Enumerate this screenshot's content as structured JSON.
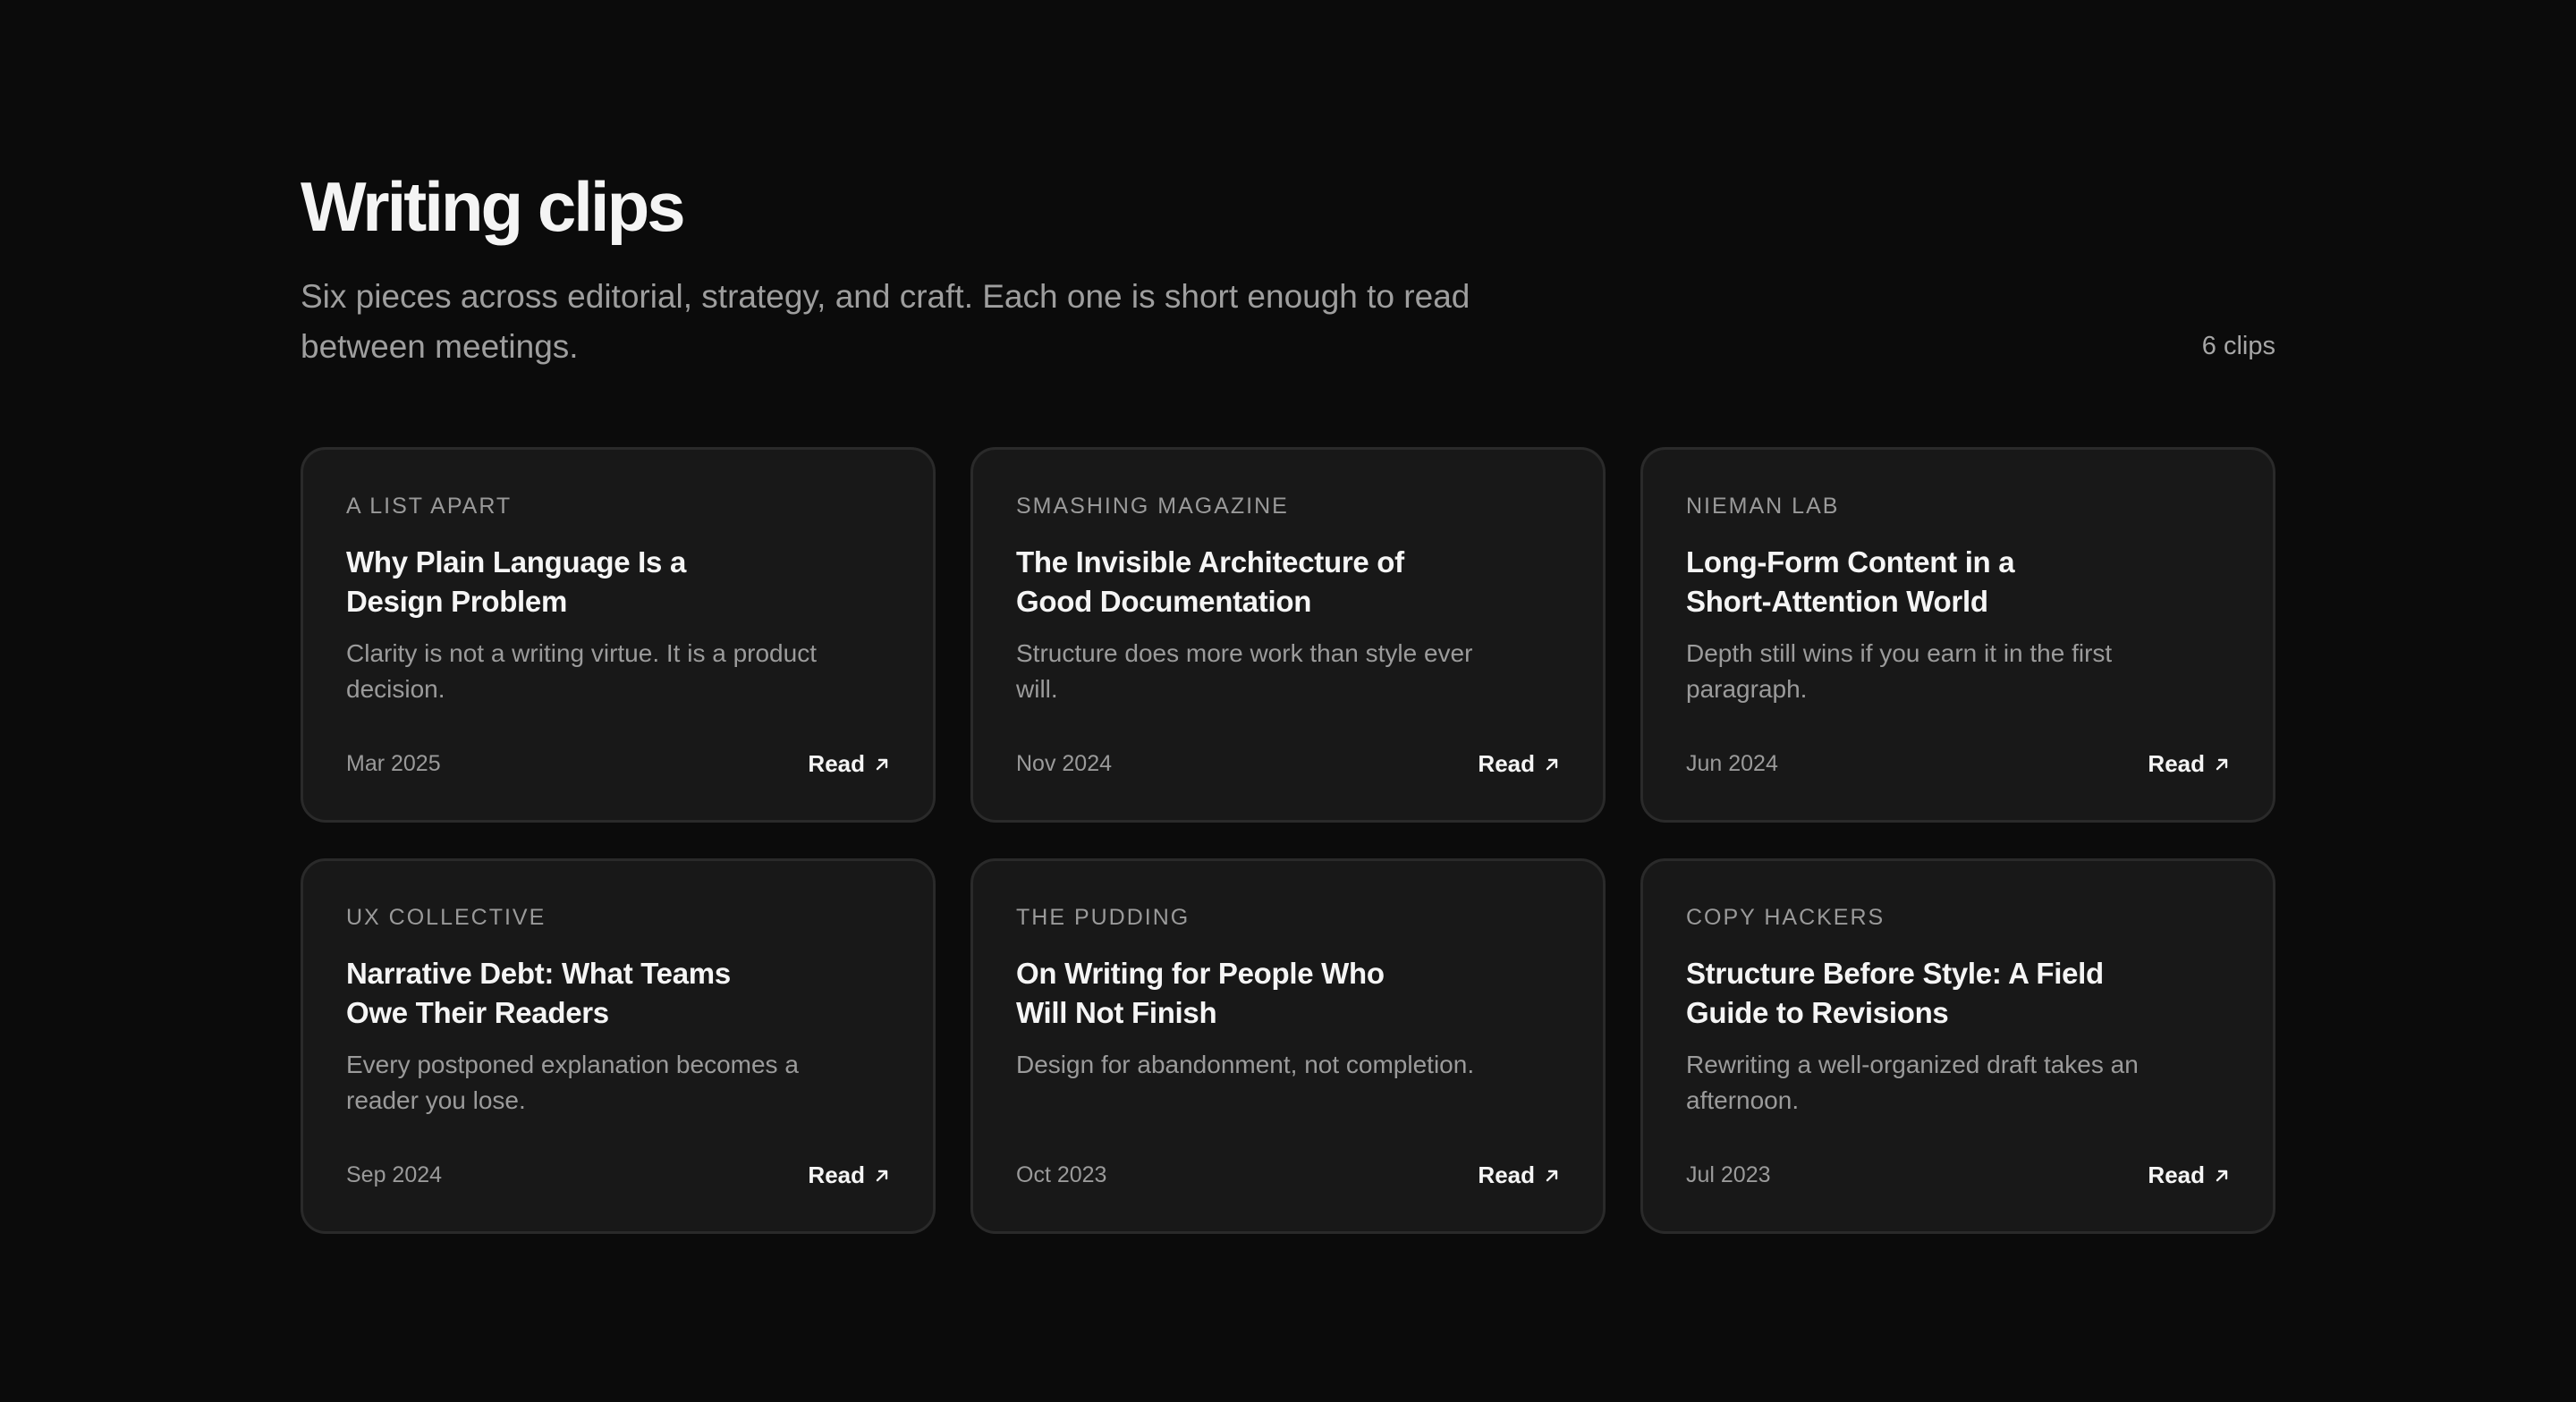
{
  "header": {
    "title": "Writing clips",
    "subtitle": "Six pieces across editorial, strategy, and craft. Each one is short enough to read between meetings.",
    "count": "6 clips"
  },
  "clips": [
    {
      "source": "A LIST APART",
      "title": "Why Plain Language Is a Design Problem",
      "description": "Clarity is not a writing virtue. It is a product decision.",
      "date": "Mar 2025",
      "link_label": "Read",
      "link_icon": "arrow-up-right-icon"
    },
    {
      "source": "SMASHING MAGAZINE",
      "title": "The Invisible Architecture of Good Documentation",
      "description": "Structure does more work than style ever will.",
      "date": "Nov 2024",
      "link_label": "Read",
      "link_icon": "arrow-up-right-icon"
    },
    {
      "source": "NIEMAN LAB",
      "title": "Long-Form Content in a Short-Attention World",
      "description": "Depth still wins if you earn it in the first paragraph.",
      "date": "Jun 2024",
      "link_label": "Read",
      "link_icon": "arrow-up-right-icon"
    },
    {
      "source": "UX COLLECTIVE",
      "title": "Narrative Debt: What Teams Owe Their Readers",
      "description": "Every postponed explanation becomes a reader you lose.",
      "date": "Sep 2024",
      "link_label": "Read",
      "link_icon": "arrow-up-right-icon"
    },
    {
      "source": "THE PUDDING",
      "title": "On Writing for People Who Will Not Finish",
      "description": "Design for abandonment, not completion.",
      "date": "Oct 2023",
      "link_label": "Read",
      "link_icon": "arrow-up-right-icon"
    },
    {
      "source": "COPY HACKERS",
      "title": "Structure Before Style: A Field Guide to Revisions",
      "description": "Rewriting a well-organized draft takes an afternoon.",
      "date": "Jul 2023",
      "link_label": "Read",
      "link_icon": "arrow-up-right-icon"
    }
  ],
  "colors": {
    "background": "#0b0b0b",
    "card": "#181818",
    "card_border": "#2a2a2a",
    "text_primary": "#f5f5f5",
    "text_muted": "#9b9b9b"
  }
}
